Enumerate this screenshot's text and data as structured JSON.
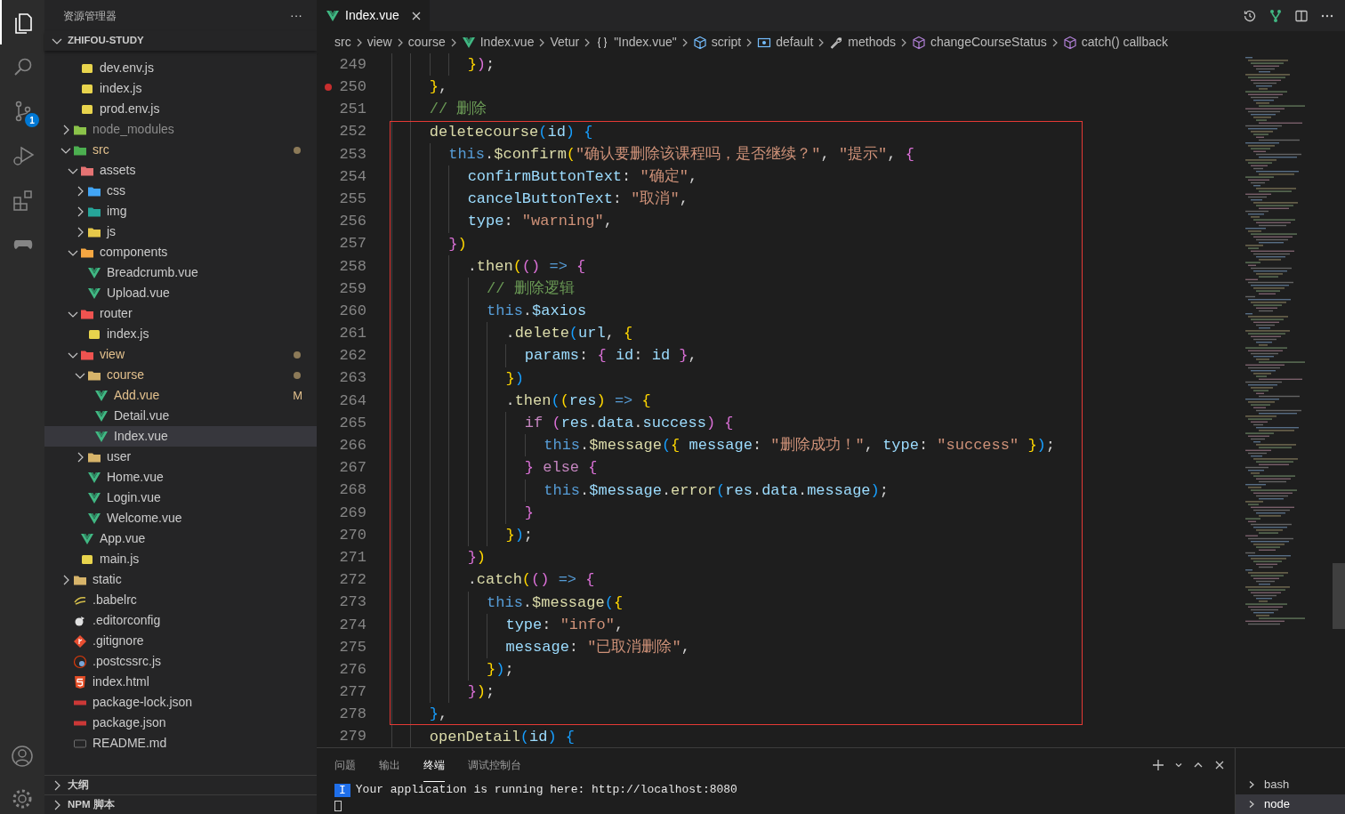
{
  "activity_bar": {
    "items": [
      {
        "kind": "files",
        "selected": true
      },
      {
        "kind": "search",
        "selected": false
      },
      {
        "kind": "source-control",
        "selected": false,
        "badge": "1"
      },
      {
        "kind": "run-debug",
        "selected": false
      },
      {
        "kind": "extensions",
        "selected": false
      },
      {
        "kind": "gamepad",
        "selected": false
      }
    ],
    "bottom": [
      {
        "kind": "account"
      },
      {
        "kind": "settings"
      }
    ]
  },
  "sidebar": {
    "title": "资源管理器",
    "more": "···",
    "section": "ZHIFOU-STUDY",
    "partial_folder_children": [
      {
        "name": "dev.env.js",
        "kind": "js",
        "selected": false,
        "modified": false,
        "ignored": false
      },
      {
        "name": "index.js",
        "kind": "js",
        "selected": false,
        "modified": false,
        "ignored": false
      },
      {
        "name": "prod.env.js",
        "kind": "js",
        "selected": false,
        "modified": false,
        "ignored": false
      }
    ],
    "items": [
      {
        "name": "node_modules",
        "kind": "folder-node",
        "expanded": false,
        "selected": false,
        "modified": false,
        "ignored": true
      },
      {
        "name": "src",
        "kind": "folder-src",
        "expanded": true,
        "selected": false,
        "modified": true,
        "ignored": false,
        "children": [
          {
            "name": "assets",
            "kind": "folder-assets",
            "expanded": true,
            "selected": false,
            "modified": false,
            "ignored": false,
            "children": [
              {
                "name": "css",
                "kind": "folder-css",
                "expanded": false,
                "selected": false,
                "modified": false,
                "ignored": false
              },
              {
                "name": "img",
                "kind": "folder-img",
                "expanded": false,
                "selected": false,
                "modified": false,
                "ignored": false
              },
              {
                "name": "js",
                "kind": "folder-js",
                "expanded": false,
                "selected": false,
                "modified": false,
                "ignored": false
              }
            ]
          },
          {
            "name": "components",
            "kind": "folder-components",
            "expanded": true,
            "selected": false,
            "modified": false,
            "ignored": false,
            "children": [
              {
                "name": "Breadcrumb.vue",
                "kind": "vue",
                "selected": false,
                "modified": false,
                "ignored": false
              },
              {
                "name": "Upload.vue",
                "kind": "vue",
                "selected": false,
                "modified": false,
                "ignored": false
              }
            ]
          },
          {
            "name": "router",
            "kind": "folder-router",
            "expanded": true,
            "selected": false,
            "modified": false,
            "ignored": false,
            "children": [
              {
                "name": "index.js",
                "kind": "js",
                "selected": false,
                "modified": false,
                "ignored": false
              }
            ]
          },
          {
            "name": "view",
            "kind": "folder-view",
            "expanded": true,
            "selected": false,
            "modified": true,
            "ignored": false,
            "children": [
              {
                "name": "course",
                "kind": "folder",
                "expanded": true,
                "selected": false,
                "modified": true,
                "ignored": false,
                "children": [
                  {
                    "name": "Add.vue",
                    "kind": "vue",
                    "selected": false,
                    "modified": true,
                    "ignored": false,
                    "badge": "M"
                  },
                  {
                    "name": "Detail.vue",
                    "kind": "vue",
                    "selected": false,
                    "modified": false,
                    "ignored": false
                  },
                  {
                    "name": "Index.vue",
                    "kind": "vue",
                    "selected": true,
                    "modified": false,
                    "ignored": false
                  }
                ]
              },
              {
                "name": "user",
                "kind": "folder",
                "expanded": false,
                "selected": false,
                "modified": false,
                "ignored": false
              },
              {
                "name": "Home.vue",
                "kind": "vue",
                "selected": false,
                "modified": false,
                "ignored": false
              },
              {
                "name": "Login.vue",
                "kind": "vue",
                "selected": false,
                "modified": false,
                "ignored": false
              },
              {
                "name": "Welcome.vue",
                "kind": "vue",
                "selected": false,
                "modified": false,
                "ignored": false
              }
            ]
          },
          {
            "name": "App.vue",
            "kind": "vue",
            "selected": false,
            "modified": false,
            "ignored": false
          },
          {
            "name": "main.js",
            "kind": "js",
            "selected": false,
            "modified": false,
            "ignored": false
          }
        ]
      },
      {
        "name": "static",
        "kind": "folder",
        "expanded": false,
        "selected": false,
        "modified": false,
        "ignored": false
      },
      {
        "name": ".babelrc",
        "kind": "babel",
        "selected": false,
        "modified": false,
        "ignored": false
      },
      {
        "name": ".editorconfig",
        "kind": "editorconfig",
        "selected": false,
        "modified": false,
        "ignored": false
      },
      {
        "name": ".gitignore",
        "kind": "git",
        "selected": false,
        "modified": false,
        "ignored": false
      },
      {
        "name": ".postcssrc.js",
        "kind": "postcss",
        "selected": false,
        "modified": false,
        "ignored": false
      },
      {
        "name": "index.html",
        "kind": "html",
        "selected": false,
        "modified": false,
        "ignored": false
      },
      {
        "name": "package-lock.json",
        "kind": "npm",
        "selected": false,
        "modified": false,
        "ignored": false
      },
      {
        "name": "package.json",
        "kind": "npm",
        "selected": false,
        "modified": false,
        "ignored": false
      },
      {
        "name": "README.md",
        "kind": "markdown",
        "selected": false,
        "modified": false,
        "ignored": false
      }
    ],
    "bottom_sections": [
      {
        "label": "大纲",
        "expanded": false
      },
      {
        "label": "NPM 脚本",
        "expanded": false
      }
    ]
  },
  "editor": {
    "tabs": [
      {
        "label": "Index.vue",
        "kind": "vue",
        "selected": true
      }
    ],
    "breadcrumbs": [
      {
        "label": "src"
      },
      {
        "label": "view"
      },
      {
        "label": "course"
      },
      {
        "label": "Index.vue",
        "kind": "vue"
      },
      {
        "label": "Vetur"
      },
      {
        "label": "\"Index.vue\"",
        "kind": "braces"
      },
      {
        "label": "script",
        "kind": "module"
      },
      {
        "label": "default",
        "kind": "field"
      },
      {
        "label": "methods",
        "kind": "wrench"
      },
      {
        "label": "changeCourseStatus",
        "kind": "method"
      },
      {
        "label": "catch() callback",
        "kind": "method"
      }
    ],
    "lines": [
      {
        "number": "249",
        "breakpoint": false,
        "tokens": [
          {
            "kind": "brace1",
            "text": "        }"
          },
          {
            "kind": "brace2",
            "text": ")"
          },
          {
            "kind": "plain",
            "text": ";"
          }
        ]
      },
      {
        "number": "250",
        "breakpoint": true,
        "tokens": [
          {
            "kind": "brace1",
            "text": "    }"
          },
          {
            "kind": "plain",
            "text": ","
          }
        ]
      },
      {
        "number": "251",
        "breakpoint": false,
        "tokens": [
          {
            "kind": "comment",
            "text": "    // 删除"
          }
        ]
      },
      {
        "number": "252",
        "breakpoint": false,
        "tokens": [
          {
            "kind": "function",
            "text": "    deletecourse"
          },
          {
            "kind": "brace3",
            "text": "("
          },
          {
            "kind": "variable",
            "text": "id"
          },
          {
            "kind": "brace3",
            "text": ") {"
          }
        ]
      },
      {
        "number": "253",
        "breakpoint": false,
        "tokens": [
          {
            "kind": "keyword",
            "text": "      this"
          },
          {
            "kind": "plain",
            "text": "."
          },
          {
            "kind": "function",
            "text": "$confirm"
          },
          {
            "kind": "brace1",
            "text": "("
          },
          {
            "kind": "string",
            "text": "\"确认要删除该课程吗，是否继续？\""
          },
          {
            "kind": "plain",
            "text": ", "
          },
          {
            "kind": "string",
            "text": "\"提示\""
          },
          {
            "kind": "plain",
            "text": ", "
          },
          {
            "kind": "brace2",
            "text": "{"
          }
        ]
      },
      {
        "number": "254",
        "breakpoint": false,
        "tokens": [
          {
            "kind": "variable",
            "text": "        confirmButtonText"
          },
          {
            "kind": "plain",
            "text": ": "
          },
          {
            "kind": "string",
            "text": "\"确定\""
          },
          {
            "kind": "plain",
            "text": ","
          }
        ]
      },
      {
        "number": "255",
        "breakpoint": false,
        "tokens": [
          {
            "kind": "variable",
            "text": "        cancelButtonText"
          },
          {
            "kind": "plain",
            "text": ": "
          },
          {
            "kind": "string",
            "text": "\"取消\""
          },
          {
            "kind": "plain",
            "text": ","
          }
        ]
      },
      {
        "number": "256",
        "breakpoint": false,
        "tokens": [
          {
            "kind": "variable",
            "text": "        type"
          },
          {
            "kind": "plain",
            "text": ": "
          },
          {
            "kind": "string",
            "text": "\"warning\""
          },
          {
            "kind": "plain",
            "text": ","
          }
        ]
      },
      {
        "number": "257",
        "breakpoint": false,
        "tokens": [
          {
            "kind": "brace2",
            "text": "      }"
          },
          {
            "kind": "brace1",
            "text": ")"
          }
        ]
      },
      {
        "number": "258",
        "breakpoint": false,
        "tokens": [
          {
            "kind": "plain",
            "text": "        ."
          },
          {
            "kind": "function",
            "text": "then"
          },
          {
            "kind": "brace1",
            "text": "("
          },
          {
            "kind": "brace2",
            "text": "() "
          },
          {
            "kind": "keyword",
            "text": "=> "
          },
          {
            "kind": "brace2",
            "text": "{"
          }
        ]
      },
      {
        "number": "259",
        "breakpoint": false,
        "tokens": [
          {
            "kind": "comment",
            "text": "          // 删除逻辑"
          }
        ]
      },
      {
        "number": "260",
        "breakpoint": false,
        "tokens": [
          {
            "kind": "keyword",
            "text": "          this"
          },
          {
            "kind": "plain",
            "text": "."
          },
          {
            "kind": "variable",
            "text": "$axios"
          }
        ]
      },
      {
        "number": "261",
        "breakpoint": false,
        "tokens": [
          {
            "kind": "plain",
            "text": "            ."
          },
          {
            "kind": "function",
            "text": "delete"
          },
          {
            "kind": "brace3",
            "text": "("
          },
          {
            "kind": "variable",
            "text": "url"
          },
          {
            "kind": "plain",
            "text": ", "
          },
          {
            "kind": "brace1",
            "text": "{"
          }
        ]
      },
      {
        "number": "262",
        "breakpoint": false,
        "tokens": [
          {
            "kind": "variable",
            "text": "              params"
          },
          {
            "kind": "plain",
            "text": ": "
          },
          {
            "kind": "brace2",
            "text": "{ "
          },
          {
            "kind": "variable",
            "text": "id"
          },
          {
            "kind": "plain",
            "text": ": "
          },
          {
            "kind": "variable",
            "text": "id "
          },
          {
            "kind": "brace2",
            "text": "}"
          },
          {
            "kind": "plain",
            "text": ","
          }
        ]
      },
      {
        "number": "263",
        "breakpoint": false,
        "tokens": [
          {
            "kind": "brace1",
            "text": "            }"
          },
          {
            "kind": "brace3",
            "text": ")"
          }
        ]
      },
      {
        "number": "264",
        "breakpoint": false,
        "tokens": [
          {
            "kind": "plain",
            "text": "            ."
          },
          {
            "kind": "function",
            "text": "then"
          },
          {
            "kind": "brace3",
            "text": "("
          },
          {
            "kind": "brace1",
            "text": "("
          },
          {
            "kind": "variable",
            "text": "res"
          },
          {
            "kind": "brace1",
            "text": ") "
          },
          {
            "kind": "keyword",
            "text": "=> "
          },
          {
            "kind": "brace1",
            "text": "{"
          }
        ]
      },
      {
        "number": "265",
        "breakpoint": false,
        "tokens": [
          {
            "kind": "control",
            "text": "              if "
          },
          {
            "kind": "brace2",
            "text": "("
          },
          {
            "kind": "variable",
            "text": "res"
          },
          {
            "kind": "plain",
            "text": "."
          },
          {
            "kind": "variable",
            "text": "data"
          },
          {
            "kind": "plain",
            "text": "."
          },
          {
            "kind": "variable",
            "text": "success"
          },
          {
            "kind": "brace2",
            "text": ") {"
          }
        ]
      },
      {
        "number": "266",
        "breakpoint": false,
        "tokens": [
          {
            "kind": "keyword",
            "text": "                this"
          },
          {
            "kind": "plain",
            "text": "."
          },
          {
            "kind": "function",
            "text": "$message"
          },
          {
            "kind": "brace3",
            "text": "("
          },
          {
            "kind": "brace1",
            "text": "{ "
          },
          {
            "kind": "variable",
            "text": "message"
          },
          {
            "kind": "plain",
            "text": ": "
          },
          {
            "kind": "string",
            "text": "\"删除成功！\""
          },
          {
            "kind": "plain",
            "text": ", "
          },
          {
            "kind": "variable",
            "text": "type"
          },
          {
            "kind": "plain",
            "text": ": "
          },
          {
            "kind": "string",
            "text": "\"success\" "
          },
          {
            "kind": "brace1",
            "text": "}"
          },
          {
            "kind": "brace3",
            "text": ")"
          },
          {
            "kind": "plain",
            "text": ";"
          }
        ]
      },
      {
        "number": "267",
        "breakpoint": false,
        "tokens": [
          {
            "kind": "brace2",
            "text": "              } "
          },
          {
            "kind": "control",
            "text": "else "
          },
          {
            "kind": "brace2",
            "text": "{"
          }
        ]
      },
      {
        "number": "268",
        "breakpoint": false,
        "tokens": [
          {
            "kind": "keyword",
            "text": "                this"
          },
          {
            "kind": "plain",
            "text": "."
          },
          {
            "kind": "variable",
            "text": "$message"
          },
          {
            "kind": "plain",
            "text": "."
          },
          {
            "kind": "function",
            "text": "error"
          },
          {
            "kind": "brace3",
            "text": "("
          },
          {
            "kind": "variable",
            "text": "res"
          },
          {
            "kind": "plain",
            "text": "."
          },
          {
            "kind": "variable",
            "text": "data"
          },
          {
            "kind": "plain",
            "text": "."
          },
          {
            "kind": "variable",
            "text": "message"
          },
          {
            "kind": "brace3",
            "text": ")"
          },
          {
            "kind": "plain",
            "text": ";"
          }
        ]
      },
      {
        "number": "269",
        "breakpoint": false,
        "tokens": [
          {
            "kind": "brace2",
            "text": "              }"
          }
        ]
      },
      {
        "number": "270",
        "breakpoint": false,
        "tokens": [
          {
            "kind": "brace1",
            "text": "            }"
          },
          {
            "kind": "brace3",
            "text": ")"
          },
          {
            "kind": "plain",
            "text": ";"
          }
        ]
      },
      {
        "number": "271",
        "breakpoint": false,
        "tokens": [
          {
            "kind": "brace2",
            "text": "        }"
          },
          {
            "kind": "brace1",
            "text": ")"
          }
        ]
      },
      {
        "number": "272",
        "breakpoint": false,
        "tokens": [
          {
            "kind": "plain",
            "text": "        ."
          },
          {
            "kind": "function",
            "text": "catch"
          },
          {
            "kind": "brace1",
            "text": "("
          },
          {
            "kind": "brace2",
            "text": "() "
          },
          {
            "kind": "keyword",
            "text": "=> "
          },
          {
            "kind": "brace2",
            "text": "{"
          }
        ]
      },
      {
        "number": "273",
        "breakpoint": false,
        "tokens": [
          {
            "kind": "keyword",
            "text": "          this"
          },
          {
            "kind": "plain",
            "text": "."
          },
          {
            "kind": "function",
            "text": "$message"
          },
          {
            "kind": "brace3",
            "text": "("
          },
          {
            "kind": "brace1",
            "text": "{"
          }
        ]
      },
      {
        "number": "274",
        "breakpoint": false,
        "tokens": [
          {
            "kind": "variable",
            "text": "            type"
          },
          {
            "kind": "plain",
            "text": ": "
          },
          {
            "kind": "string",
            "text": "\"info\""
          },
          {
            "kind": "plain",
            "text": ","
          }
        ]
      },
      {
        "number": "275",
        "breakpoint": false,
        "tokens": [
          {
            "kind": "variable",
            "text": "            message"
          },
          {
            "kind": "plain",
            "text": ": "
          },
          {
            "kind": "string",
            "text": "\"已取消删除\""
          },
          {
            "kind": "plain",
            "text": ","
          }
        ]
      },
      {
        "number": "276",
        "breakpoint": false,
        "tokens": [
          {
            "kind": "brace1",
            "text": "          }"
          },
          {
            "kind": "brace3",
            "text": ")"
          },
          {
            "kind": "plain",
            "text": ";"
          }
        ]
      },
      {
        "number": "277",
        "breakpoint": false,
        "tokens": [
          {
            "kind": "brace2",
            "text": "        }"
          },
          {
            "kind": "brace1",
            "text": ")"
          },
          {
            "kind": "plain",
            "text": ";"
          }
        ]
      },
      {
        "number": "278",
        "breakpoint": false,
        "tokens": [
          {
            "kind": "brace3",
            "text": "    }"
          },
          {
            "kind": "plain",
            "text": ","
          }
        ]
      },
      {
        "number": "279",
        "breakpoint": false,
        "tokens": [
          {
            "kind": "function",
            "text": "    openDetail"
          },
          {
            "kind": "brace3",
            "text": "("
          },
          {
            "kind": "variable",
            "text": "id"
          },
          {
            "kind": "brace3",
            "text": ") {"
          }
        ]
      }
    ]
  },
  "panel": {
    "tabs": [
      {
        "label": "问题",
        "selected": false
      },
      {
        "label": "输出",
        "selected": false
      },
      {
        "label": "终端",
        "selected": true
      },
      {
        "label": "调试控制台",
        "selected": false
      }
    ],
    "terminal": {
      "marker": "I",
      "text": "Your application is running here: http://localhost:8080"
    },
    "terminals": [
      {
        "label": "bash",
        "selected": false
      },
      {
        "label": "node",
        "selected": true
      }
    ]
  }
}
